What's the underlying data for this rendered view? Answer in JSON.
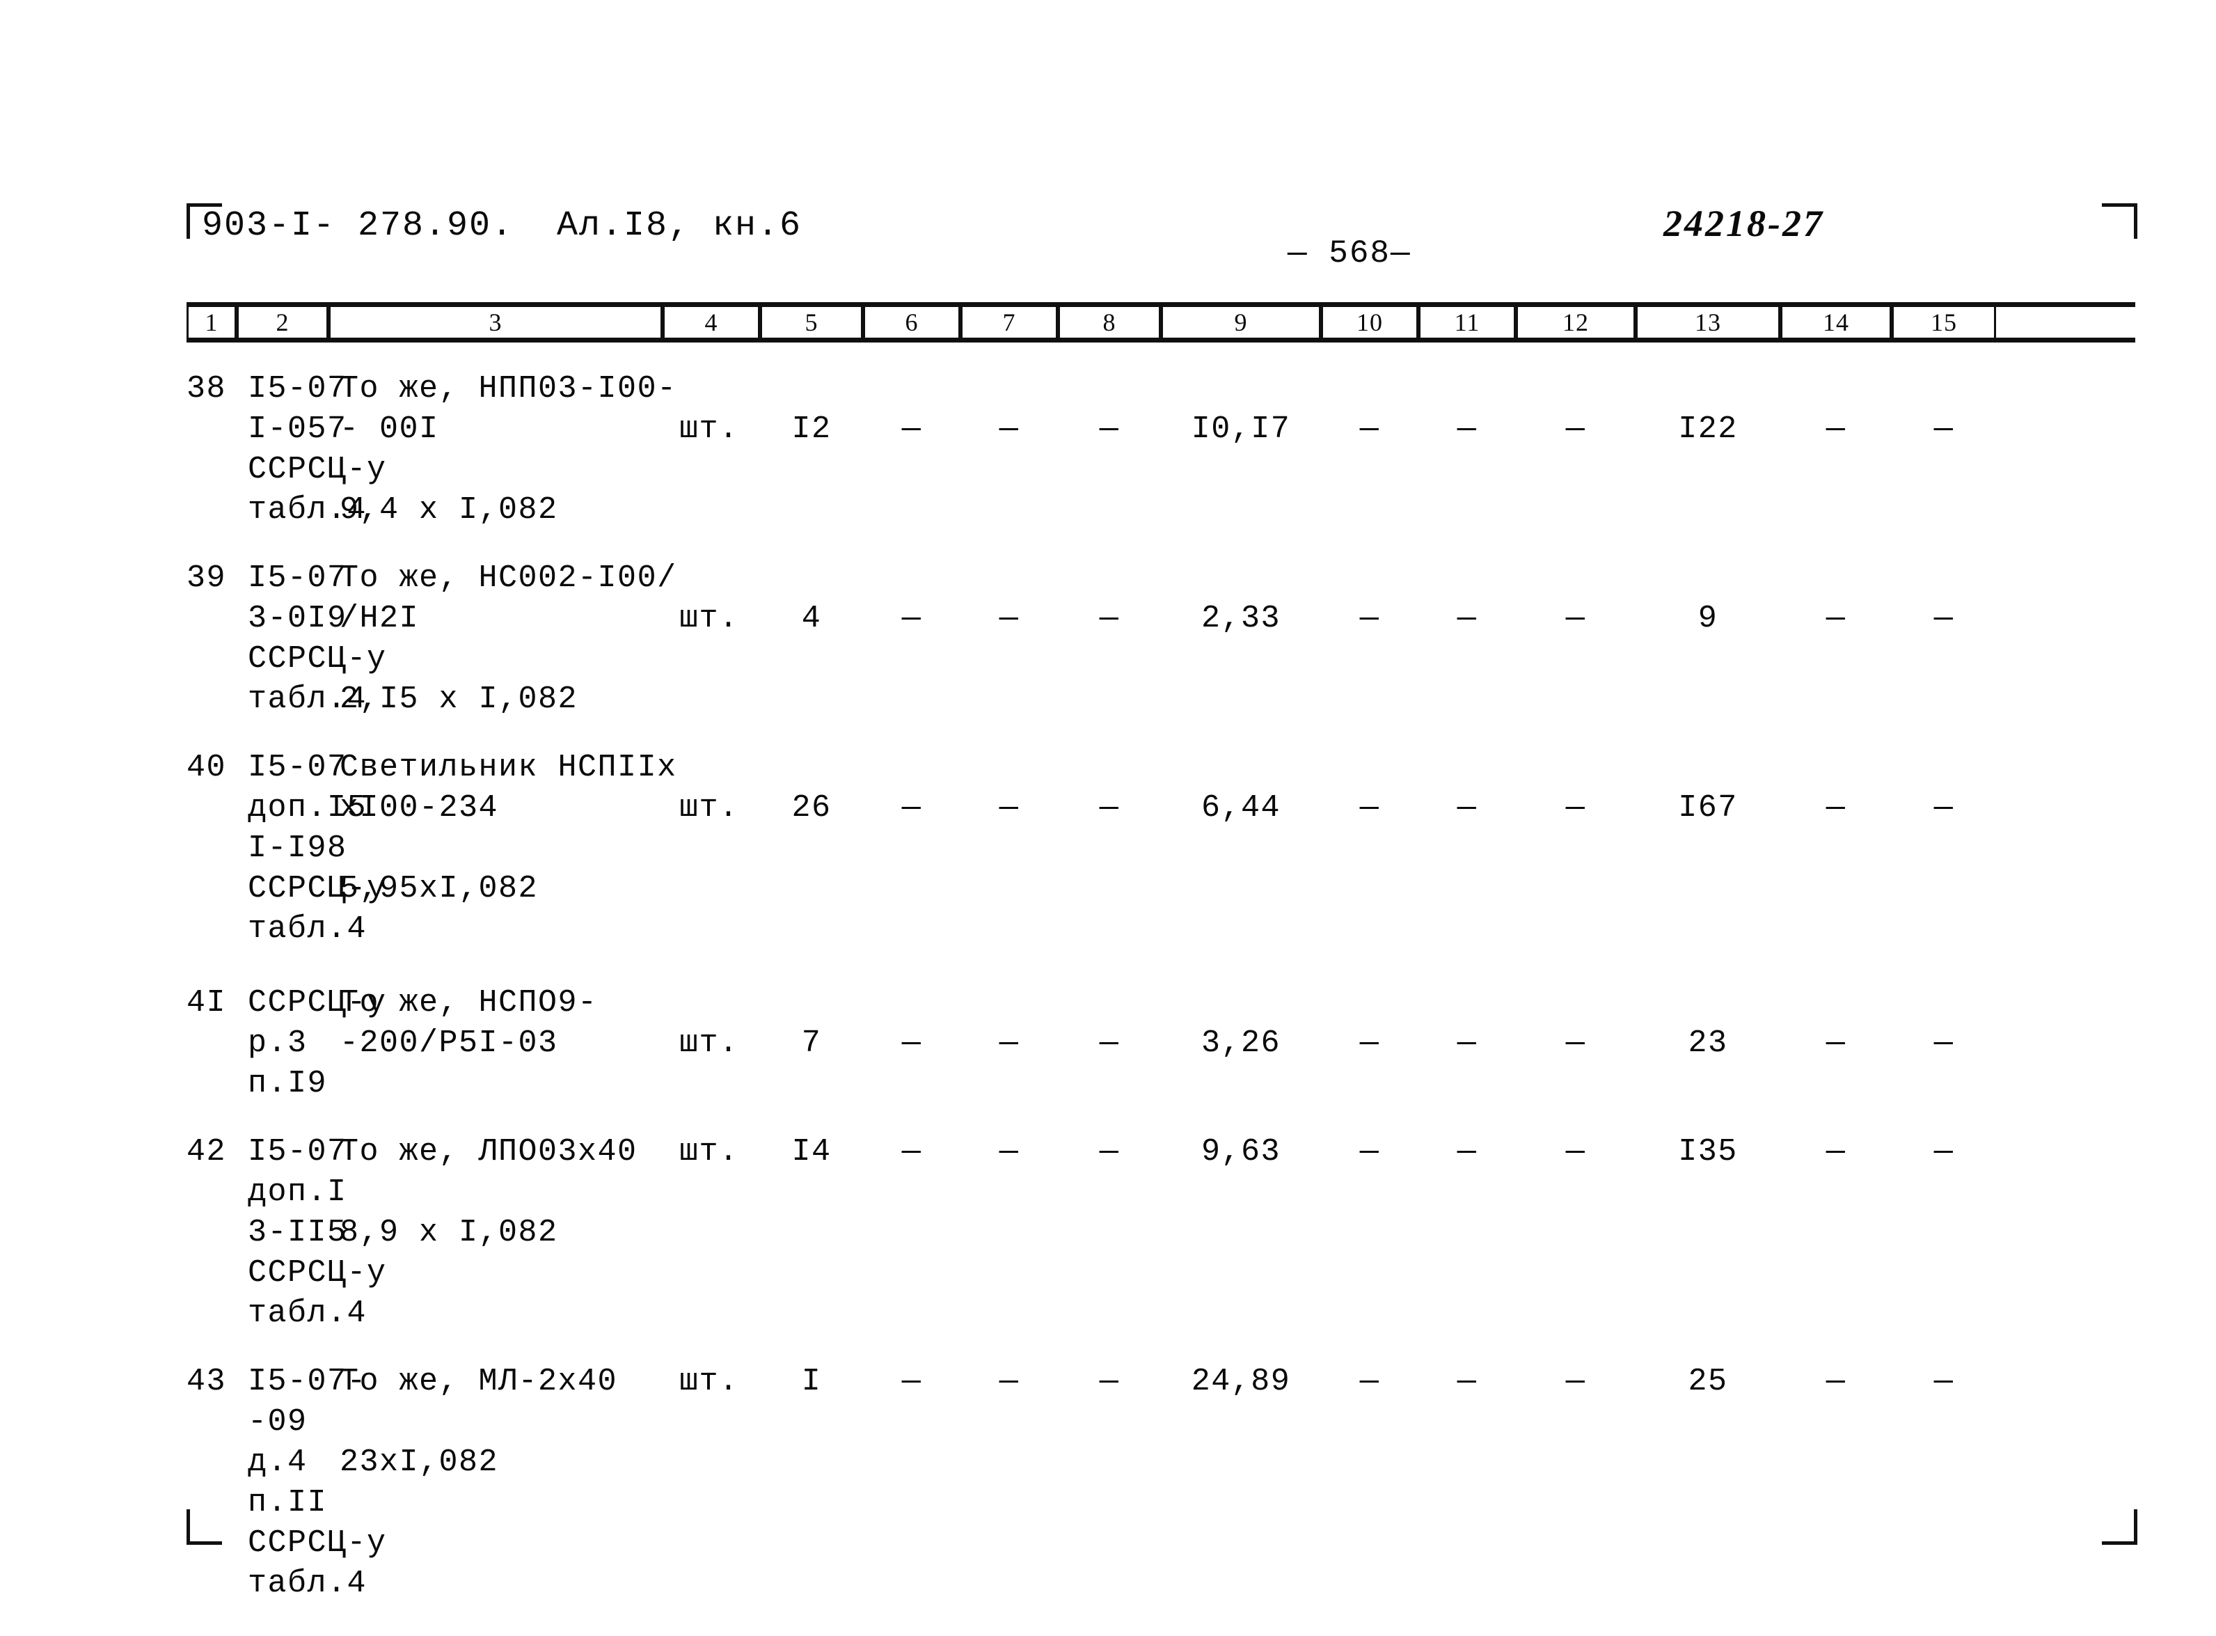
{
  "header": {
    "doc_code": "903-I- 278.90.",
    "album": "Ал.I8, кн.6",
    "page_number": "— 568—",
    "stamp_number": "24218-27"
  },
  "table": {
    "column_numbers": [
      "1",
      "2",
      "3",
      "4",
      "5",
      "6",
      "7",
      "8",
      "9",
      "10",
      "11",
      "12",
      "13",
      "14",
      "15"
    ],
    "rows": [
      {
        "num": "38",
        "code": "I5-07\nI-057\nССРСЦ-у\nтабл.4",
        "name": "То же, НПП03-I00-\n- 00I\n\n9,4 х I,082",
        "unit": "шт.",
        "c5": "I2",
        "c6": "—",
        "c7": "—",
        "c8": "—",
        "c9": "I0,I7",
        "c10": "—",
        "c11": "—",
        "c12": "—",
        "c13": "I22",
        "c14": "—",
        "c15": "—"
      },
      {
        "num": "39",
        "code": "I5-07\n3-0I9\nССРСЦ-у\nтабл.4",
        "name": "То же, НС002-I00/\n/Н2I\n\n2,I5 х I,082",
        "unit": "шт.",
        "c5": "4",
        "c6": "—",
        "c7": "—",
        "c8": "—",
        "c9": "2,33",
        "c10": "—",
        "c11": "—",
        "c12": "—",
        "c13": "9",
        "c14": "—",
        "c15": "—"
      },
      {
        "num": "40",
        "code": "I5-07\nдоп.I5\nI-I98\nССРСЦ-у\nтабл.4",
        "name": "Светильник НСПIIх\nхI00-234\n\n5,95хI,082",
        "unit": "шт.",
        "c5": "26",
        "c6": "—",
        "c7": "—",
        "c8": "—",
        "c9": "6,44",
        "c10": "—",
        "c11": "—",
        "c12": "—",
        "c13": "I67",
        "c14": "—",
        "c15": "—"
      },
      {
        "num": "4I",
        "code": "ССРСЦ-у\nр.3\nп.I9",
        "name": "То же, НСПО9-\n-200/Р5I-03",
        "unit": "шт.",
        "c5": "7",
        "c6": "—",
        "c7": "—",
        "c8": "—",
        "c9": "3,26",
        "c10": "—",
        "c11": "—",
        "c12": "—",
        "c13": "23",
        "c14": "—",
        "c15": "—"
      },
      {
        "num": "42",
        "code": "I5-07\nдоп.I\n3-II5\nССРСЦ-у\nтабл.4",
        "name": "То же, ЛПО03х40\n\n8,9 х I,082",
        "unit": "шт.",
        "c5": "I4",
        "c6": "—",
        "c7": "—",
        "c8": "—",
        "c9": "9,63",
        "c10": "—",
        "c11": "—",
        "c12": "—",
        "c13": "I35",
        "c14": "—",
        "c15": "—"
      },
      {
        "num": "43",
        "code": "I5-07-\n-09\nд.4\nп.II\nССРСЦ-у\nтабл.4",
        "name": "То же, МЛ-2х40\n\n23хI,082",
        "unit": "шт.",
        "c5": "I",
        "c6": "—",
        "c7": "—",
        "c8": "—",
        "c9": "24,89",
        "c10": "—",
        "c11": "—",
        "c12": "—",
        "c13": "25",
        "c14": "—",
        "c15": "—"
      }
    ]
  }
}
